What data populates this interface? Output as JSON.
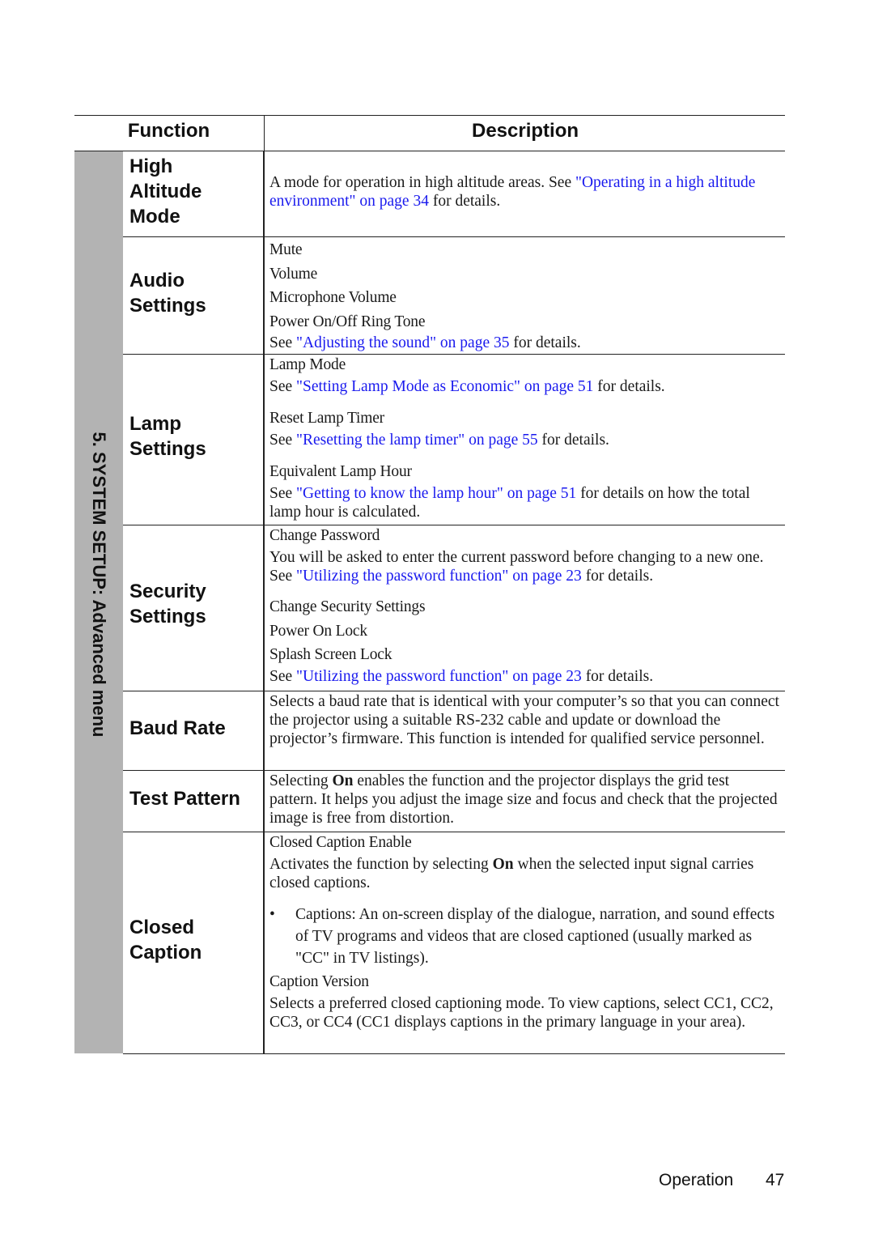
{
  "table": {
    "headers": {
      "function": "Function",
      "description": "Description"
    },
    "side_label": "5. SYSTEM SETUP: Advanced menu",
    "rows": {
      "high_altitude": {
        "name": "High Altitude Mode",
        "desc_pre": "A mode for operation in high altitude areas. See ",
        "desc_link": "\"Operating in a high altitude environment\" on page 34",
        "desc_post": " for details."
      },
      "audio": {
        "name": "Audio Settings",
        "items": [
          "Mute",
          "Volume",
          "Microphone Volume",
          "Power On/Off Ring Tone"
        ],
        "see_pre": "See ",
        "see_link": "\"Adjusting the sound\" on page 35",
        "see_post": " for details."
      },
      "lamp": {
        "name": "Lamp Settings",
        "lamp_mode": "Lamp Mode",
        "lamp_mode_see_pre": "See ",
        "lamp_mode_link": "\"Setting Lamp Mode as Economic\" on page 51",
        "lamp_mode_see_post": " for details.",
        "reset": "Reset Lamp Timer",
        "reset_see_pre": "See ",
        "reset_link": "\"Resetting the lamp timer\" on page 55",
        "reset_see_post": " for details.",
        "equiv": "Equivalent Lamp Hour",
        "equiv_see_pre": "See ",
        "equiv_link": "\"Getting to know the lamp hour\" on page 51",
        "equiv_see_post": " for details on how the total lamp hour is calculated."
      },
      "security": {
        "name": "Security Settings",
        "change_pw": "Change Password",
        "change_pw_desc_pre": "You will be asked to enter the current password before changing to a new one. See ",
        "change_pw_link": "\"Utilizing the password function\" on page 23",
        "change_pw_desc_post": " for details.",
        "items": [
          "Change Security Settings",
          "Power On Lock",
          "Splash Screen Lock"
        ],
        "see_pre": "See ",
        "see_link": "\"Utilizing the password function\" on page 23",
        "see_post": " for details."
      },
      "baud": {
        "name": "Baud Rate",
        "desc": "Selects a baud rate that is identical with your computer’s so that you can connect the projector using a suitable RS-232 cable and update or download the projector’s firmware. This function is intended for qualified service personnel."
      },
      "test_pattern": {
        "name": "Test Pattern",
        "desc_pre": "Selecting ",
        "desc_bold": "On",
        "desc_post": " enables the function and the projector displays the grid test pattern. It helps you adjust the image size and focus and check that the projected image is free from distortion."
      },
      "closed_caption": {
        "name": "Closed Caption",
        "enable": "Closed Caption Enable",
        "enable_desc_pre": "Activates the function by selecting ",
        "enable_desc_bold": "On",
        "enable_desc_post": " when the selected input signal carries closed captions.",
        "bullet_mark": "•",
        "bullet_text": "Captions: An on-screen display of the dialogue, narration, and sound effects of TV programs and videos that are closed captioned (usually marked as \"CC\" in TV listings).",
        "version": "Caption Version",
        "version_desc": "Selects a preferred closed captioning mode. To view captions, select CC1, CC2, CC3, or CC4 (CC1 displays captions in the primary language in your area)."
      }
    }
  },
  "footer": {
    "section": "Operation",
    "page_number": "47"
  },
  "colors": {
    "link": "#1a1aee",
    "side_strip": "#b3b3b3",
    "rule": "#222222"
  }
}
